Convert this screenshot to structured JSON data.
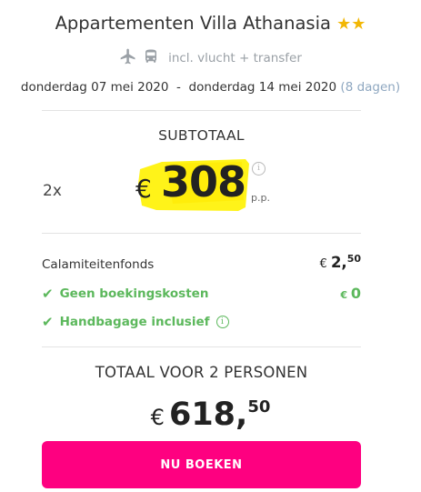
{
  "accommodation": {
    "name": "Appartementen Villa Athanasia",
    "stars": "★★"
  },
  "package": {
    "includes_text": "incl. vlucht + transfer",
    "icons": [
      "plane-icon",
      "bus-icon"
    ]
  },
  "dates": {
    "range": "donderdag 07 mei 2020  -  donderdag 14 mei 2020",
    "duration": "(8 dagen)"
  },
  "subtotal": {
    "label": "SUBTOTAAL",
    "quantity": "2x",
    "currency": "€",
    "price": "308",
    "per_person": "p.p.",
    "info_symbol": "i"
  },
  "fees": {
    "calamity_label": "Calamiteitenfonds",
    "calamity_currency": "€",
    "calamity_whole": "2,",
    "calamity_cents": "50",
    "booking_label": "Geen boekingskosten",
    "booking_currency": "€",
    "booking_value": "0",
    "handbag_label": "Handbagage inclusief",
    "check_symbol": "✔"
  },
  "total": {
    "label": "TOTAAL VOOR 2 PERSONEN",
    "currency": "€",
    "whole": "618,",
    "cents": "50"
  },
  "actions": {
    "book_label": "NU BOEKEN"
  },
  "colors": {
    "accent": "#fe0080",
    "success": "#5cb85c",
    "star": "#f2b705",
    "highlight": "#fff200"
  }
}
